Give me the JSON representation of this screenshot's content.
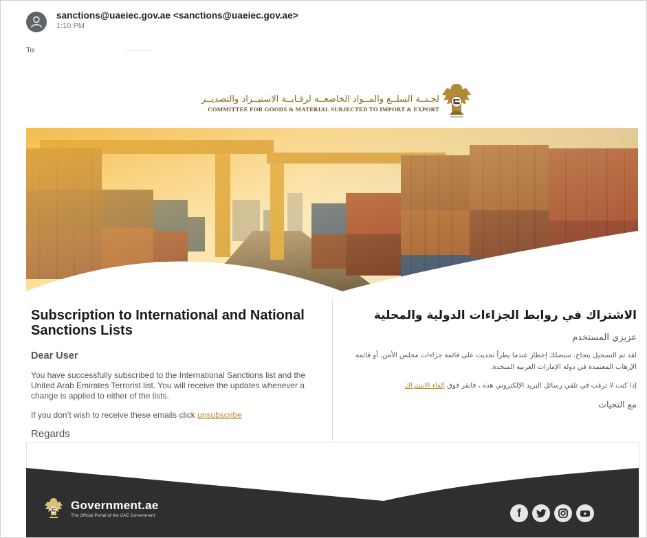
{
  "email": {
    "sender_name": "sanctions@uaeiec.gov.ae",
    "sender_address": "<sanctions@uaeiec.gov.ae>",
    "time": "1:10 PM",
    "to_label": "To:"
  },
  "committee": {
    "name_ar": "لجـنــة السلــع والمــواد الخاضعــة لرقـابــة الاستيــراد والتصديــر",
    "name_en": "COMMITTEE FOR GOODS & MATERIAL SUBJECTED TO IMPORT & EXPORT"
  },
  "english": {
    "title": "Subscription to International and National Sanctions Lists",
    "greeting": "Dear User",
    "body": "You have successfully subscribed to the International Sanctions list and the United Arab Emirates Terrorist list. You will receive the updates whenever a change is applied to either of the lists.",
    "unsubscribe_prefix": "If you don’t wish to receive these emails click ",
    "unsubscribe_link": "unsubscribe",
    "regards": "Regards"
  },
  "arabic": {
    "title": "الاشتراك في روابط الجزاءات الدولية والمحلية",
    "greeting": "عزيزي المستخدم",
    "body": "لقد تم التسجيل بنجاح. سيصلك إخطار عندما يطرأ تحديث على قائمة جزاءات مجلس الأمن، أو قائمة الإرهاب المعتمدة في دولة الإمارات العربية المتحدة.",
    "unsubscribe_prefix": "إذا كنت لا ترغب في تلقي رسائل البريد الإلكتروني هذه ، فانقر فوق ",
    "unsubscribe_link": "إلغاء الاشتراك",
    "regards": "مع التحيات"
  },
  "footer": {
    "portal_name": "Government.ae",
    "portal_tagline": "The Official Portal of the UAE Government",
    "social_icons": [
      "facebook-icon",
      "twitter-icon",
      "instagram-icon",
      "youtube-icon"
    ]
  },
  "colors": {
    "accent_gold": "#b7882b",
    "footer_dark": "#2f2f2f"
  }
}
